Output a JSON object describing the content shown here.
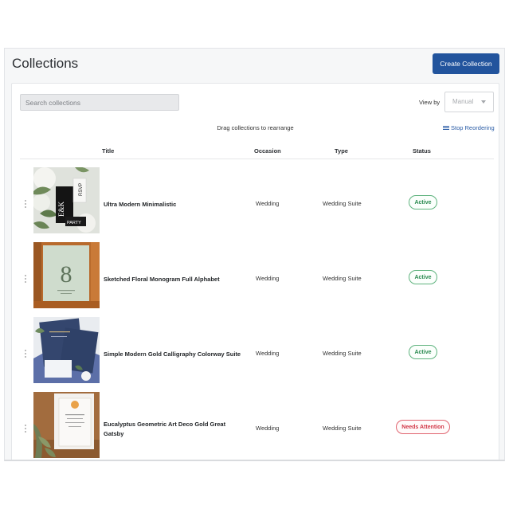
{
  "page": {
    "title": "Collections",
    "create_button": "Create Collection"
  },
  "toolbar": {
    "search_placeholder": "Search collections",
    "view_by_label": "View by",
    "view_by_value": "Manual",
    "drag_hint": "Drag collections to rearrange",
    "stop_reordering": "Stop Reordering"
  },
  "table": {
    "headers": {
      "title": "Title",
      "occasion": "Occasion",
      "type": "Type",
      "status": "Status"
    },
    "rows": [
      {
        "title": "Ultra Modern Minimalistic",
        "occasion": "Wedding",
        "type": "Wedding Suite",
        "status": "Active",
        "thumb_text": [
          "E&K",
          "RSVP",
          "PARTY"
        ]
      },
      {
        "title": "Sketched Floral Monogram Full Alphabet",
        "occasion": "Wedding",
        "type": "Wedding Suite",
        "status": "Active",
        "thumb_text": [
          "8"
        ]
      },
      {
        "title": "Simple Modern Gold Calligraphy Colorway Suite",
        "occasion": "Wedding",
        "type": "Wedding Suite",
        "status": "Active",
        "thumb_text": []
      },
      {
        "title": "Eucalyptus Geometric Art Deco Gold Great Gatsby",
        "occasion": "Wedding",
        "type": "Wedding Suite",
        "status": "Needs Attention",
        "thumb_text": []
      }
    ]
  },
  "colors": {
    "primary_button": "#22549d",
    "link": "#2a5ca6",
    "status_active": "#2a8a50",
    "status_attention": "#d23848"
  }
}
